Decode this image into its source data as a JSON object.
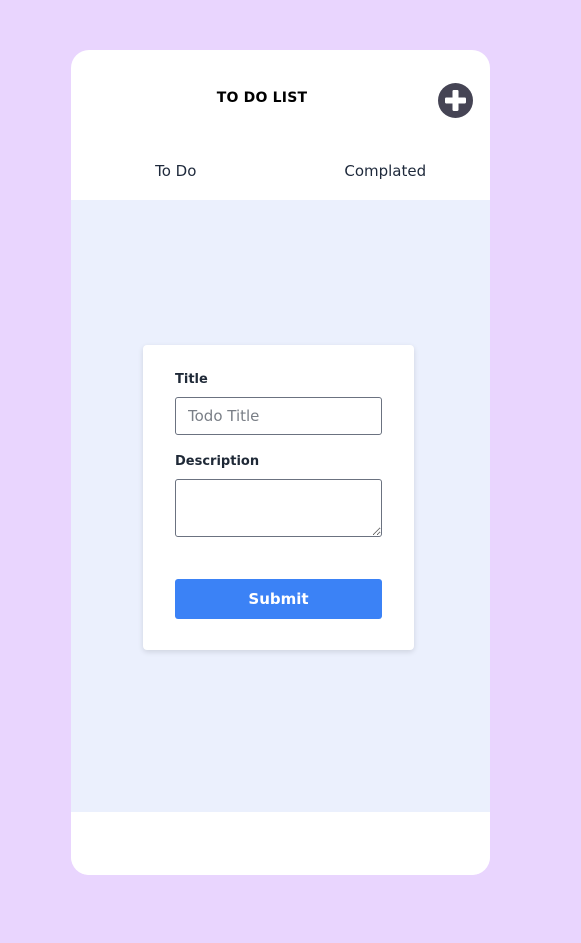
{
  "app": {
    "title": "TO DO LIST",
    "add_icon": "plus-circle-icon"
  },
  "tabs": [
    {
      "label": "To Do"
    },
    {
      "label": "Complated"
    }
  ],
  "form": {
    "title_label": "Title",
    "title_placeholder": "Todo Title",
    "title_value": "",
    "description_label": "Description",
    "description_value": "",
    "submit_label": "Submit"
  },
  "colors": {
    "page_background": "#e9d5fe",
    "content_background": "#ebf0fd",
    "accent": "#3b82f6",
    "add_button": "#454454"
  }
}
